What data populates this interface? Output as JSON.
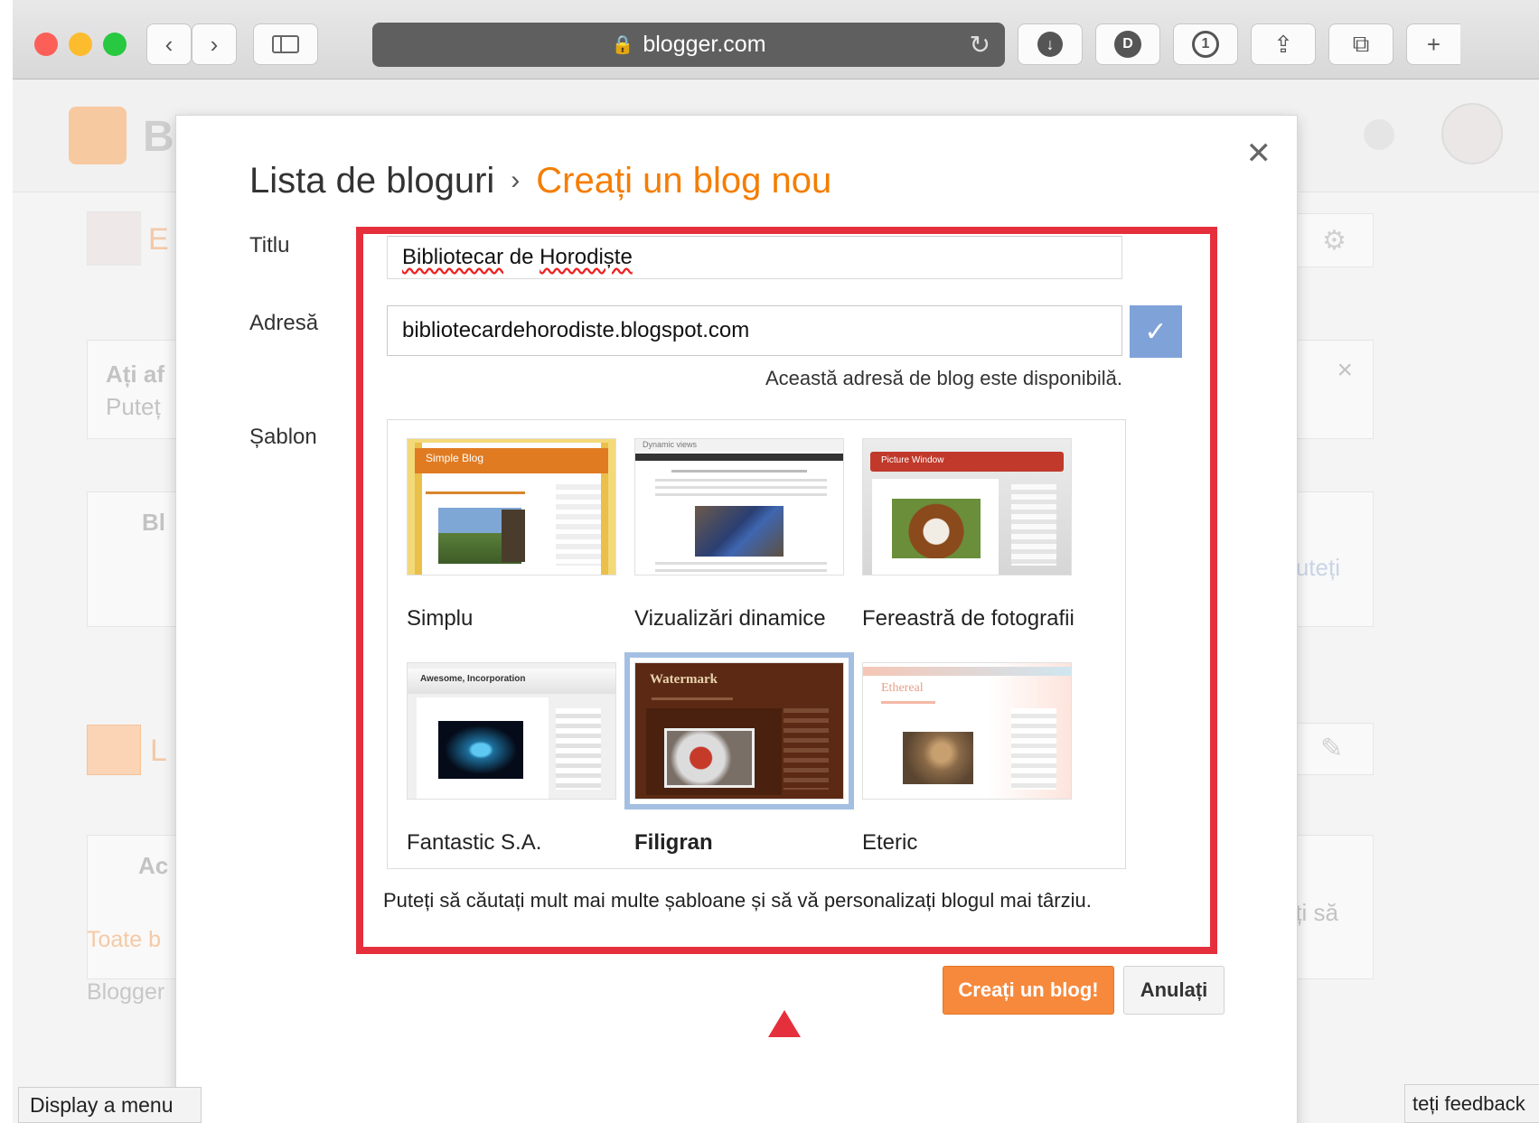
{
  "browser": {
    "url": "blogger.com",
    "buttons": [
      "back",
      "forward",
      "sidebar",
      "downloads",
      "extension-1",
      "extension-2",
      "share",
      "tabs",
      "new-tab"
    ]
  },
  "background_page": {
    "logo_text": "Bl",
    "card1_title": "Ați af",
    "card1_sub": "Puteț",
    "card2_text": "Bl",
    "card_ac": "Ac",
    "toate_text": "Toate b",
    "blogger_text": "Blogger",
    "right_text1": "uteți",
    "right_text2": "ți să",
    "e_letter": "E",
    "l_letter": "L"
  },
  "modal": {
    "breadcrumb_parent": "Lista de bloguri",
    "breadcrumb_separator": "›",
    "breadcrumb_current": "Creați un blog nou",
    "title_label": "Titlu",
    "title_value_parts": [
      "Bibliotecar",
      " de ",
      "Horodiște"
    ],
    "address_label": "Adresă",
    "address_value": "bibliotecardehorodiste.blogspot.com",
    "address_status": "Această adresă de blog este disponibilă.",
    "template_label": "Șablon",
    "templates": [
      {
        "name": "Simplu",
        "thumb_title": "Simple Blog",
        "selected": false
      },
      {
        "name": "Vizualizări dinamice",
        "thumb_title": "Dynamic views",
        "selected": false
      },
      {
        "name": "Fereastră de fotografii",
        "thumb_title": "Picture Window",
        "selected": false
      },
      {
        "name": "Fantastic S.A.",
        "thumb_title": "Awesome, Incorporation",
        "selected": false
      },
      {
        "name": "Filigran",
        "thumb_title": "Watermark",
        "selected": true
      },
      {
        "name": "Eteric",
        "thumb_title": "Ethereal",
        "selected": false
      }
    ],
    "hint": "Puteți să căutați mult mai multe șabloane și să vă personalizați blogul mai târziu.",
    "create_button": "Creați un blog!",
    "cancel_button": "Anulați"
  },
  "overlays": {
    "menu_tooltip": "Display a menu",
    "feedback": "teți feedback"
  },
  "colors": {
    "accent_orange": "#f57d00",
    "highlight_red": "#e62f3c",
    "check_blue": "#7fa2d8"
  }
}
